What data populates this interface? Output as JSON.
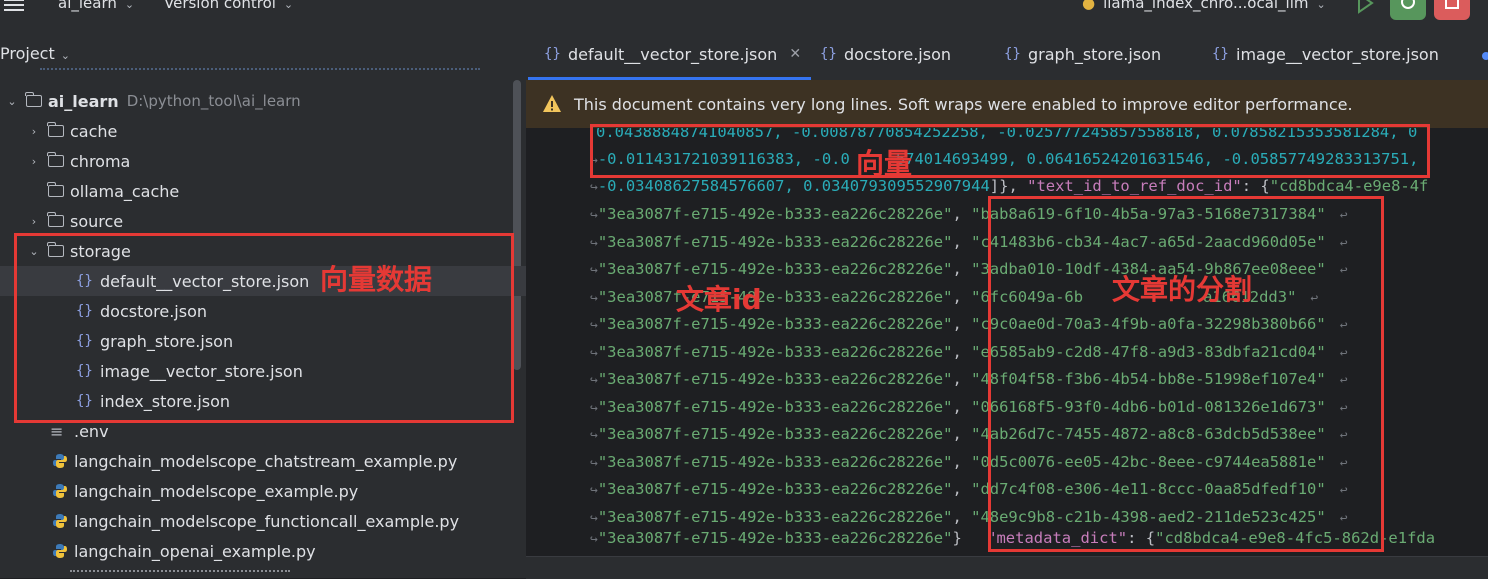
{
  "titlebar": {
    "project_name": "ai_learn",
    "vcs": "Version control",
    "run_config": "llama_index_chro...ocal_llm"
  },
  "project_panel": {
    "title": "Project",
    "items": [
      {
        "label": "ai_learn",
        "hint": "D:\\python_tool\\ai_learn",
        "type": "folder",
        "expanded": true
      },
      {
        "label": "cache",
        "type": "folder"
      },
      {
        "label": "chroma",
        "type": "folder"
      },
      {
        "label": "ollama_cache",
        "type": "folder"
      },
      {
        "label": "source",
        "type": "folder"
      },
      {
        "label": "storage",
        "type": "folder",
        "expanded": true
      },
      {
        "label": "default__vector_store.json",
        "type": "json",
        "selected": true
      },
      {
        "label": "docstore.json",
        "type": "json"
      },
      {
        "label": "graph_store.json",
        "type": "json"
      },
      {
        "label": "image__vector_store.json",
        "type": "json"
      },
      {
        "label": "index_store.json",
        "type": "json"
      },
      {
        "label": ".env",
        "type": "env"
      },
      {
        "label": "langchain_modelscope_chatstream_example.py",
        "type": "py"
      },
      {
        "label": "langchain_modelscope_example.py",
        "type": "py"
      },
      {
        "label": "langchain_modelscope_functioncall_example.py",
        "type": "py"
      },
      {
        "label": "langchain_openai_example.py",
        "type": "py"
      }
    ]
  },
  "editor": {
    "tabs": [
      {
        "label": "default__vector_store.json",
        "active": true
      },
      {
        "label": "docstore.json"
      },
      {
        "label": "graph_store.json"
      },
      {
        "label": "image__vector_store.json"
      }
    ],
    "banner": "This document contains very long lines. Soft wraps were enabled to improve editor performance.",
    "vector_line_1": [
      "0.04388848741040857,",
      "-0.00878770854252258,",
      "-0.025777245857558818,",
      "0.07858215353581284,",
      "0"
    ],
    "vector_line_2": [
      "-0.011431721039116383,",
      "-0.0",
      "574014693499,",
      "0.06416524201631546,",
      "-0.05857749283313751,"
    ],
    "vector_line_3": [
      "-0.03408627584576607,",
      "0.034079309552907944",
      "]}, ",
      "\"text_id_to_ref_doc_id\"",
      ": {",
      "\"cd8bdca4-e9e8-4f"
    ],
    "doc_id": "\"3ea3087f-e715-492e-b333-ea226c28226e\"",
    "chunk_ids": [
      "\"bab8a619-6f10-4b5a-97a3-5168e7317384\"",
      "\"c41483b6-cb34-4ac7-a65d-2aacd960d05e\"",
      "\"3adba010-10df-4384-aa54-9b867ee08eee\"",
      "\"6fc6049a-6b",
      "\"c9c0ae0d-70a3-4f9b-a0fa-32298b380b66\"",
      "\"e6585ab9-c2d8-47f8-a9d3-83dbfa21cd04\"",
      "\"48f04f58-f3b6-4b54-bb8e-51998ef107e4\"",
      "\"066168f5-93f0-4db6-b01d-081326e1d673\"",
      "\"4ab26d7c-7455-4872-a8c8-63dcb5d538ee\"",
      "\"0d5c0076-ee05-42bc-8eee-c9744ea5881e\"",
      "\"dd7c4f08-e306-4e11-8ccc-0aa85dfedf10\"",
      "\"48e9c9b8-c21b-4398-aed2-211de523c425\""
    ],
    "chunk_ids_tail_4": "a16612dd3\"",
    "last_line": {
      "close": "}",
      "key": "\"metadata_dict\"",
      "colon": ": {",
      "value": "\"cd8bdca4-e9e8-4fc5-862d-e1fda"
    }
  },
  "annotations": {
    "vector_label": "向量",
    "storage_label": "向量数据",
    "doc_id_label": "文章id",
    "chunk_label": "文章的分割"
  },
  "colors": {
    "annotation": "#e53935",
    "accent": "#3574f0"
  }
}
